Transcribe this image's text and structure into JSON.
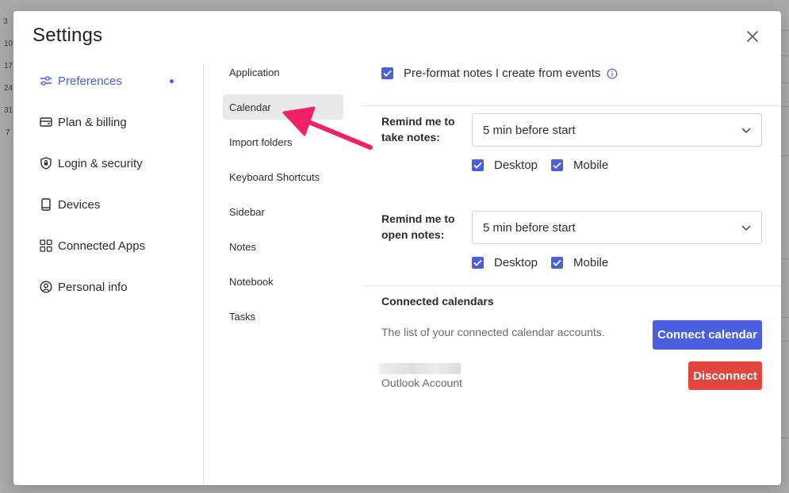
{
  "background": {
    "calendar_numbers": [
      "3",
      "10",
      "17",
      "24",
      "31",
      "7"
    ]
  },
  "modal": {
    "title": "Settings"
  },
  "nav": {
    "items": [
      {
        "label": "Preferences",
        "icon": "sliders-icon",
        "active": true
      },
      {
        "label": "Plan & billing",
        "icon": "credit-card-icon"
      },
      {
        "label": "Login & security",
        "icon": "shield-lock-icon"
      },
      {
        "label": "Devices",
        "icon": "mobile-device-icon"
      },
      {
        "label": "Connected Apps",
        "icon": "apps-grid-icon"
      },
      {
        "label": "Personal info",
        "icon": "user-circle-icon"
      }
    ]
  },
  "subnav": {
    "items": [
      {
        "label": "Application"
      },
      {
        "label": "Calendar",
        "active": true
      },
      {
        "label": "Import folders"
      },
      {
        "label": "Keyboard Shortcuts"
      },
      {
        "label": "Sidebar"
      },
      {
        "label": "Notes"
      },
      {
        "label": "Notebook"
      },
      {
        "label": "Tasks"
      }
    ]
  },
  "calendar": {
    "preformat_label": "Pre-format notes I create from events",
    "preformat_checked": true,
    "remind_take": {
      "label_line1": "Remind me to",
      "label_line2": "take notes:",
      "selected": "5 min before start",
      "desktop_label": "Desktop",
      "mobile_label": "Mobile",
      "desktop_checked": true,
      "mobile_checked": true
    },
    "remind_open": {
      "label_line1": "Remind me to",
      "label_line2": "open notes:",
      "selected": "5 min before start",
      "desktop_label": "Desktop",
      "mobile_label": "Mobile",
      "desktop_checked": true,
      "mobile_checked": true
    },
    "connected": {
      "title": "Connected calendars",
      "description": "The list of your connected calendar accounts.",
      "connect_button": "Connect calendar",
      "account_type": "Outlook Account",
      "disconnect_button": "Disconnect"
    }
  },
  "colors": {
    "accent": "#4a5ee0",
    "danger": "#e2453c",
    "annotation_arrow": "#f0206a"
  }
}
